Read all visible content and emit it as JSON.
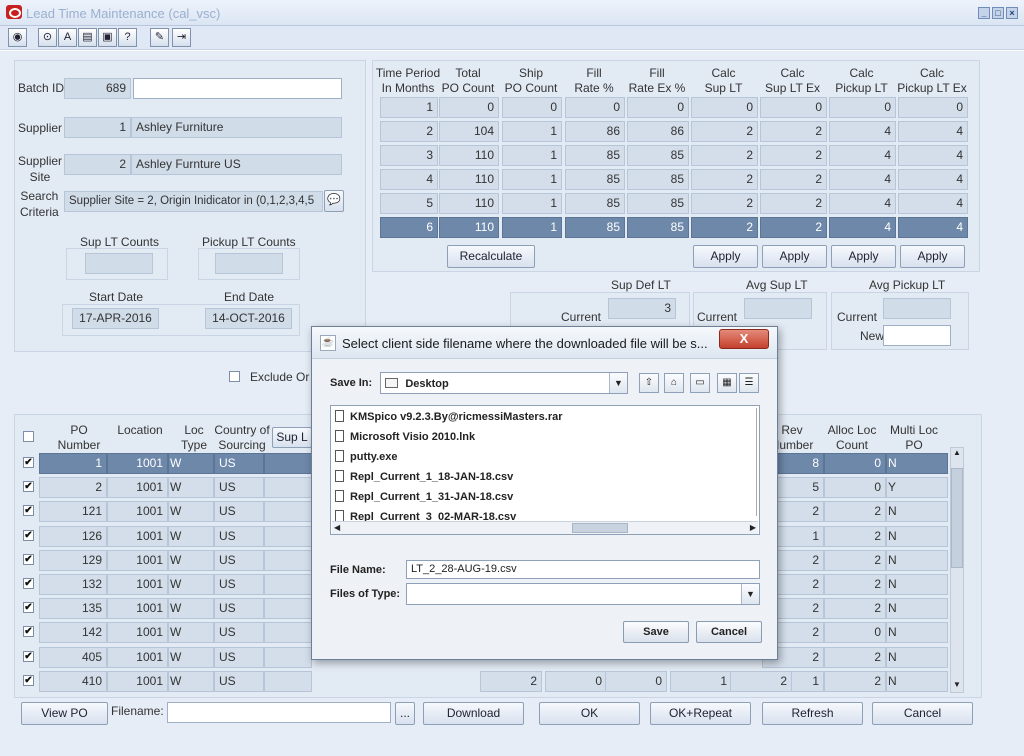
{
  "window": {
    "title": "Lead Time Maintenance (cal_vsc)"
  },
  "colors": {
    "selected_row": "#6e88aa",
    "readonly_field": "#d3deea",
    "panel": "#e2eaf4"
  },
  "toolbar": {
    "icons": [
      "globe-icon",
      "help-icon",
      "spellcheck-icon",
      "copy-icon",
      "print-icon",
      "question-icon",
      "attach-icon",
      "export-icon"
    ]
  },
  "header": {
    "batch_id_label": "Batch ID",
    "batch_id": "689",
    "batch_desc": "",
    "supplier_label": "Supplier",
    "supplier_id": "1",
    "supplier_name": "Ashley Furniture",
    "supplier_site_label": "Supplier\nSite",
    "site_id": "2",
    "site_name": "Ashley Furnture US",
    "search_label": "Search\nCriteria",
    "search_criteria": "Supplier Site = 2, Origin Inidicator in (0,1,2,3,4,5",
    "sup_lt_counts_label": "Sup LT Counts",
    "pickup_lt_counts_label": "Pickup LT Counts",
    "start_date_label": "Start Date",
    "start_date": "17-APR-2016",
    "end_date_label": "End Date",
    "end_date": "14-OCT-2016"
  },
  "period_table": {
    "headers": [
      [
        "Time Period",
        "In Months"
      ],
      [
        "Total",
        "PO Count"
      ],
      [
        "Ship",
        "PO Count"
      ],
      [
        "Fill",
        "Rate %"
      ],
      [
        "Fill",
        "Rate Ex %"
      ],
      [
        "Calc",
        "Sup LT"
      ],
      [
        "Calc",
        "Sup LT Ex"
      ],
      [
        "Calc",
        "Pickup LT"
      ],
      [
        "Calc",
        "Pickup LT Ex"
      ]
    ],
    "rows": [
      [
        "1",
        "0",
        "0",
        "0",
        "0",
        "0",
        "0",
        "0",
        "0"
      ],
      [
        "2",
        "104",
        "1",
        "86",
        "86",
        "2",
        "2",
        "4",
        "4"
      ],
      [
        "3",
        "110",
        "1",
        "85",
        "85",
        "2",
        "2",
        "4",
        "4"
      ],
      [
        "4",
        "110",
        "1",
        "85",
        "85",
        "2",
        "2",
        "4",
        "4"
      ],
      [
        "5",
        "110",
        "1",
        "85",
        "85",
        "2",
        "2",
        "4",
        "4"
      ],
      [
        "6",
        "110",
        "1",
        "85",
        "85",
        "2",
        "2",
        "4",
        "4"
      ]
    ],
    "selected_row": 5,
    "recalculate": "Recalculate",
    "apply": "Apply"
  },
  "defaults": {
    "sup_def_lt_label": "Sup Def LT",
    "sup_def_lt_current": "3",
    "avg_sup_lt_label": "Avg Sup LT",
    "avg_pickup_lt_label": "Avg Pickup LT",
    "current_label": "Current",
    "new_label": "New"
  },
  "exclude_label": "Exclude Or",
  "po_table": {
    "headers_left": [
      [
        "PO",
        "Number"
      ],
      [
        "",
        "Location"
      ],
      [
        "Loc",
        "Type"
      ],
      [
        "Country of",
        "Sourcing"
      ]
    ],
    "sup_lt_button": "Sup L",
    "headers_right": [
      [
        "Rev",
        "Number"
      ],
      [
        "Alloc Loc",
        "Count"
      ],
      [
        "Multi Loc",
        "PO"
      ]
    ],
    "rows": [
      {
        "checked": true,
        "po": "1",
        "loc": "1001",
        "type": "W",
        "country": "US",
        "rev": "8",
        "alloc": "0",
        "multi": "N"
      },
      {
        "checked": true,
        "po": "2",
        "loc": "1001",
        "type": "W",
        "country": "US",
        "rev": "5",
        "alloc": "0",
        "multi": "Y"
      },
      {
        "checked": true,
        "po": "121",
        "loc": "1001",
        "type": "W",
        "country": "US",
        "rev": "2",
        "alloc": "2",
        "multi": "N"
      },
      {
        "checked": true,
        "po": "126",
        "loc": "1001",
        "type": "W",
        "country": "US",
        "rev": "1",
        "alloc": "2",
        "multi": "N"
      },
      {
        "checked": true,
        "po": "129",
        "loc": "1001",
        "type": "W",
        "country": "US",
        "rev": "2",
        "alloc": "2",
        "multi": "N"
      },
      {
        "checked": true,
        "po": "132",
        "loc": "1001",
        "type": "W",
        "country": "US",
        "rev": "2",
        "alloc": "2",
        "multi": "N"
      },
      {
        "checked": true,
        "po": "135",
        "loc": "1001",
        "type": "W",
        "country": "US",
        "rev": "2",
        "alloc": "2",
        "multi": "N"
      },
      {
        "checked": true,
        "po": "142",
        "loc": "1001",
        "type": "W",
        "country": "US",
        "rev": "2",
        "alloc": "0",
        "multi": "N"
      },
      {
        "checked": true,
        "po": "405",
        "loc": "1001",
        "type": "W",
        "country": "US",
        "rev": "2",
        "alloc": "2",
        "multi": "N"
      },
      {
        "checked": true,
        "po": "410",
        "loc": "1001",
        "type": "W",
        "country": "US",
        "rev": "1",
        "alloc": "2",
        "multi": "N"
      }
    ],
    "last_row_mid_values": [
      "2",
      "0",
      "0",
      "1",
      "2"
    ]
  },
  "footer": {
    "view_po": "View PO",
    "filename_label": "Filename:",
    "filename_value": "",
    "browse": "...",
    "download": "Download",
    "ok": "OK",
    "ok_repeat": "OK+Repeat",
    "refresh": "Refresh",
    "cancel": "Cancel"
  },
  "dialog": {
    "title": "Select client side filename where the downloaded file will be s...",
    "close": "X",
    "save_in_label": "Save In:",
    "save_in_value": "Desktop",
    "files": [
      "KMSpico v9.2.3.By@ricmessiMasters.rar",
      "Microsoft Visio 2010.lnk",
      "putty.exe",
      "Repl_Current_1_18-JAN-18.csv",
      "Repl_Current_1_31-JAN-18.csv",
      "Repl_Current_3_02-MAR-18.csv"
    ],
    "file_name_label": "File Name:",
    "file_name_value": "LT_2_28-AUG-19.csv",
    "file_type_label": "Files of Type:",
    "file_type_value": "",
    "save": "Save",
    "cancel": "Cancel"
  }
}
